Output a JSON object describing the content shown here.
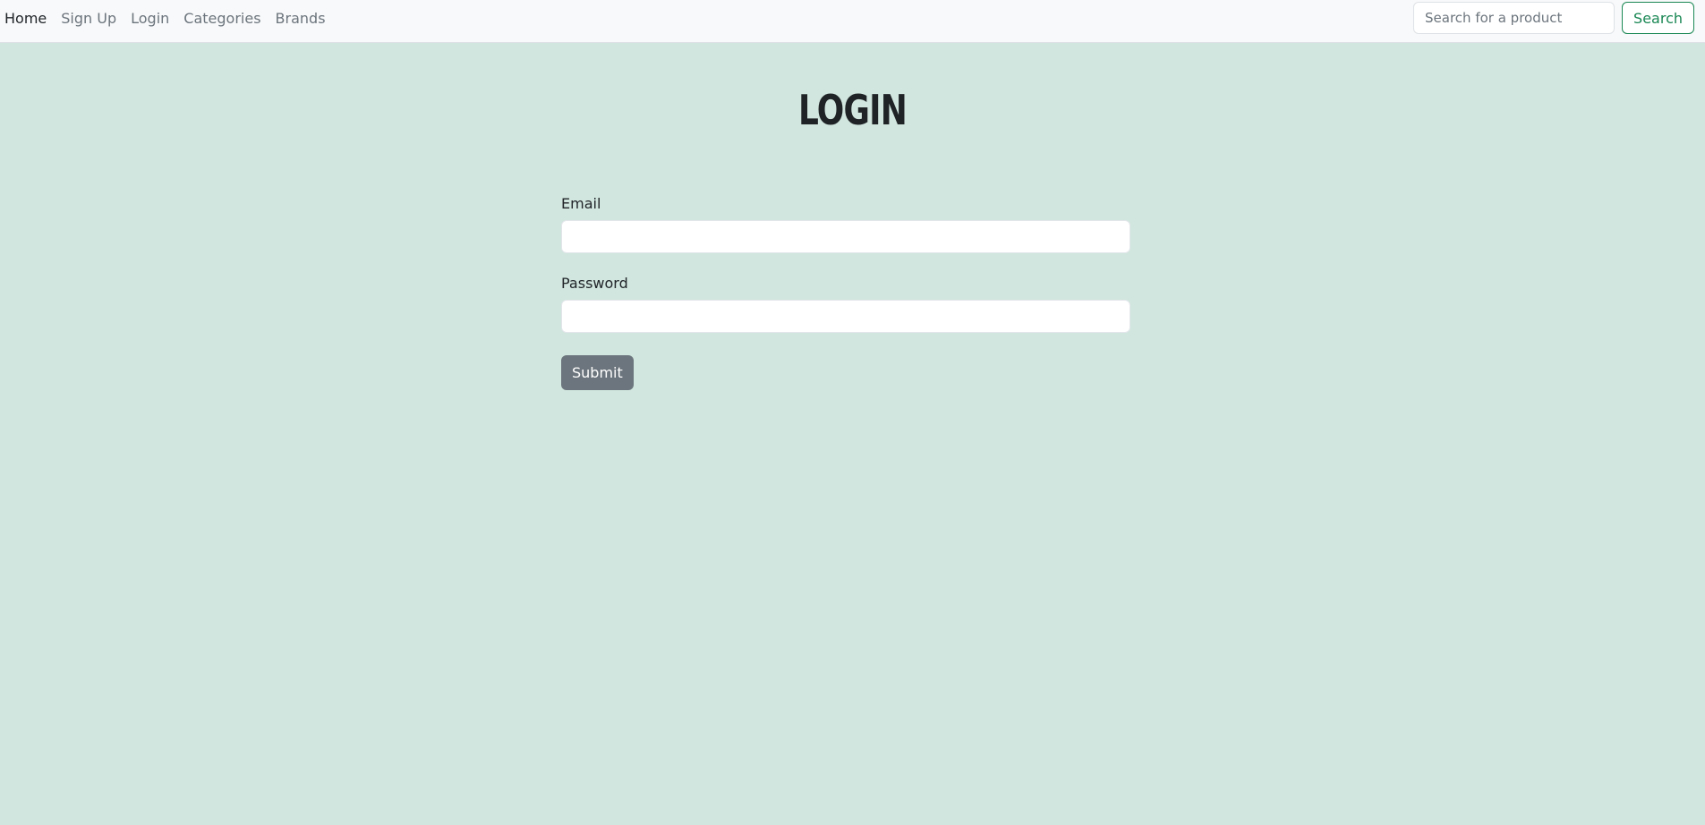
{
  "nav": {
    "links": [
      "Home",
      "Sign Up",
      "Login",
      "Categories",
      "Brands"
    ],
    "active": "Home"
  },
  "search": {
    "placeholder": "Search for a product",
    "button_label": "Search"
  },
  "page": {
    "title": "LOGIN"
  },
  "form": {
    "email_label": "Email",
    "email_value": "",
    "password_label": "Password",
    "password_value": "",
    "submit_label": "Submit"
  },
  "colors": {
    "background": "#d1e6de",
    "navbar": "#f8f9fa",
    "accent": "#198754",
    "submit": "#6c757d"
  }
}
